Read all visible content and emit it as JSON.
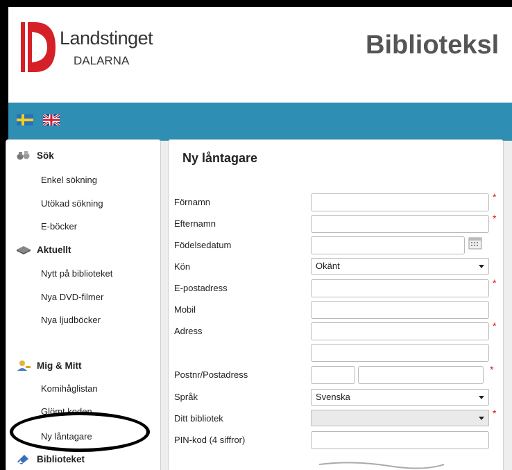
{
  "header": {
    "logo_name": "Landstinget",
    "logo_sub": "DALARNA",
    "site_title": "Biblioteksl",
    "brand_red": "#d62027"
  },
  "langbar": {
    "color": "#2e8eb3",
    "flags": [
      "swedish-flag-icon",
      "uk-flag-icon"
    ]
  },
  "sidebar": {
    "sections": [
      {
        "title": "Sök",
        "icon": "binoculars-icon",
        "items": [
          "Enkel sökning",
          "Utökad sökning",
          "E-böcker"
        ]
      },
      {
        "title": "Aktuellt",
        "icon": "open-book-icon",
        "items": [
          "Nytt på biblioteket",
          "Nya DVD-filmer",
          "Nya ljudböcker"
        ]
      },
      {
        "title": "Mig & Mitt",
        "icon": "user-key-icon",
        "items": [
          "Komihåglistan",
          "Glömt koden",
          "Ny låntagare"
        ]
      },
      {
        "title": "Biblioteket",
        "icon": "book-pen-icon",
        "items": []
      }
    ]
  },
  "form": {
    "title": "Ny låntagare",
    "fields": {
      "fornamn": {
        "label": "Förnamn",
        "value": "",
        "required": true
      },
      "efternamn": {
        "label": "Efternamn",
        "value": "",
        "required": true
      },
      "fodelsedatum": {
        "label": "Födelsedatum",
        "value": "",
        "required": false
      },
      "kon": {
        "label": "Kön",
        "value": "Okänt",
        "required": false
      },
      "epost": {
        "label": "E-postadress",
        "value": "",
        "required": true
      },
      "mobil": {
        "label": "Mobil",
        "value": "",
        "required": false
      },
      "adress": {
        "label": "Adress",
        "value": "",
        "value2": "",
        "required": true
      },
      "postnr": {
        "label": "Postnr/Postadress",
        "value": "",
        "value2": "",
        "required": true
      },
      "sprak": {
        "label": "Språk",
        "value": "Svenska",
        "required": false
      },
      "bibliotek": {
        "label": "Ditt bibliotek",
        "value": "",
        "required": true
      },
      "pin": {
        "label": "PIN-kod (4 siffror)",
        "value": "",
        "required": false
      }
    },
    "required_marker": "*"
  }
}
